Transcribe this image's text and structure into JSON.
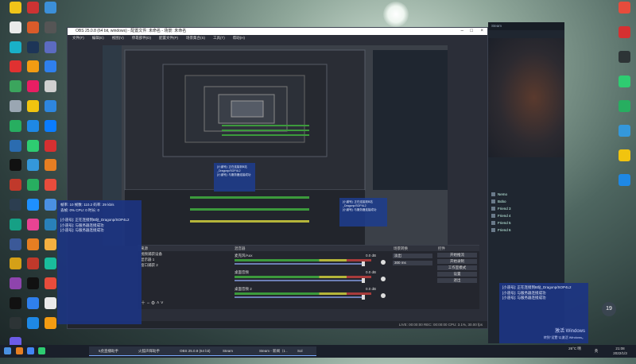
{
  "desktop_left_icons": [
    {
      "label": "",
      "color": "#f0c419"
    },
    {
      "label": "",
      "color": "#cc3333"
    },
    {
      "label": "",
      "color": "#3c8fd8"
    },
    {
      "label": "",
      "color": "#eaeaea"
    },
    {
      "label": "",
      "color": "#d95b2a"
    },
    {
      "label": "",
      "color": "#555555"
    },
    {
      "label": "",
      "color": "#19b0c8"
    },
    {
      "label": "",
      "color": "#1d3557"
    },
    {
      "label": "",
      "color": "#5c6bc0"
    },
    {
      "label": "",
      "color": "#e03131"
    },
    {
      "label": "",
      "color": "#f39c12"
    },
    {
      "label": "",
      "color": "#2f80ed"
    },
    {
      "label": "",
      "color": "#3ba55d"
    },
    {
      "label": "",
      "color": "#e91e63"
    },
    {
      "label": "",
      "color": "#d0d0d0"
    },
    {
      "label": "",
      "color": "#9aa6b2"
    },
    {
      "label": "",
      "color": "#f1c40f"
    },
    {
      "label": "",
      "color": "#2e86de"
    },
    {
      "label": "",
      "color": "#27ae60"
    },
    {
      "label": "",
      "color": "#1e88e5"
    },
    {
      "label": "",
      "color": "#0a7cff"
    },
    {
      "label": "",
      "color": "#2b6cb0"
    },
    {
      "label": "",
      "color": "#2ecc71"
    },
    {
      "label": "",
      "color": "#d63031"
    },
    {
      "label": "",
      "color": "#111111"
    },
    {
      "label": "",
      "color": "#3498db"
    },
    {
      "label": "",
      "color": "#e67e22"
    },
    {
      "label": "",
      "color": "#c0392b"
    },
    {
      "label": "",
      "color": "#27ae60"
    },
    {
      "label": "",
      "color": "#e74c3c"
    },
    {
      "label": "",
      "color": "#2c3e50"
    },
    {
      "label": "",
      "color": "#1e90ff"
    },
    {
      "label": "",
      "color": "#4a90e2"
    },
    {
      "label": "",
      "color": "#16a085"
    },
    {
      "label": "",
      "color": "#e84393"
    },
    {
      "label": "",
      "color": "#2980b9"
    },
    {
      "label": "",
      "color": "#3b5998"
    },
    {
      "label": "",
      "color": "#e67e22"
    },
    {
      "label": "",
      "color": "#f5b041"
    },
    {
      "label": "",
      "color": "#d4a017"
    },
    {
      "label": "",
      "color": "#c0392b"
    },
    {
      "label": "",
      "color": "#1abc9c"
    },
    {
      "label": "",
      "color": "#8e44ad"
    },
    {
      "label": "",
      "color": "#111111"
    },
    {
      "label": "",
      "color": "#e74c3c"
    },
    {
      "label": "",
      "color": "#111111"
    },
    {
      "label": "",
      "color": "#2f80ed"
    },
    {
      "label": "",
      "color": "#eaeaea"
    },
    {
      "label": "",
      "color": "#2d3436"
    },
    {
      "label": "",
      "color": "#1e88e5"
    },
    {
      "label": "",
      "color": "#f39c12"
    },
    {
      "label": "",
      "color": "#6c5ce7"
    }
  ],
  "desktop_right_icons": [
    {
      "label": "",
      "color": "#e74c3c"
    },
    {
      "label": "",
      "color": "#d63031"
    },
    {
      "label": "",
      "color": "#2d3436"
    },
    {
      "label": "",
      "color": "#2ecc71"
    },
    {
      "label": "",
      "color": "#27ae60"
    },
    {
      "label": "",
      "color": "#3498db"
    },
    {
      "label": "",
      "color": "#f1c40f"
    },
    {
      "label": "",
      "color": "#1e88e5"
    }
  ],
  "obs": {
    "title": "OBS 25.0.8 (64 bit, windows) - 配置文件: 未命名 - 场景: 未命名",
    "menu": [
      "文件(F)",
      "编辑(E)",
      "视图(V)",
      "停靠部件(D)",
      "配置文件(P)",
      "场景集合(S)",
      "工具(T)",
      "帮助(H)"
    ],
    "scenes_title": "场景",
    "sources_title": "来源",
    "sources": [
      "视频捕获设备",
      "显示器 1",
      "窗口捕获 2"
    ],
    "mixer_title": "混音器",
    "mixer_channels": [
      {
        "name": "麦克风/Aux",
        "db": "0.0 dB"
      },
      {
        "name": "桌面音频",
        "db": "0.0 dB"
      },
      {
        "name": "桌面音频 2",
        "db": "0.0 dB"
      }
    ],
    "transitions_title": "场景转换",
    "transition_select": "淡出",
    "transition_duration": "300 ms",
    "controls_title": "控件",
    "controls": [
      "开始推流",
      "开始录制",
      "工作室模式",
      "设置",
      "退出"
    ],
    "status": "LIVE: 00:00:00   REC: 00:00:00   CPU: 3.1%, 30.00 fps"
  },
  "notifications": [
    {
      "lines": [
        "[小道号]: 正在连接到B站_Dragonp/SOP4L2",
        "[小道号]: 与服务器连接成功",
        "[小道号]: 与服务器连接成功"
      ]
    },
    {
      "lines": [
        "[小道号]: 正在连接到B站_Dragonp/SOP4L2",
        "[小道号]: 与服务器连接成功",
        "[小道号]: 与服务器连接成功"
      ]
    }
  ],
  "overlay_stats": {
    "row1": "帧率: 10   帧数: 110.2   码率: 29 kb/s",
    "row2": "丢帧: 0%   CPU: 0   时长: 0"
  },
  "steam": {
    "header": "Steam",
    "friends": [
      "Nemo",
      "Bobo",
      "Friend 3",
      "Friend 4",
      "Friend 5",
      "Friend 6"
    ]
  },
  "activate_windows": {
    "line1": "激活 Windows",
    "line2": "转到\"设置\"以激活 Windows。"
  },
  "taskbar": {
    "tasks": [
      "5虎直播助手",
      "火狐声辉助手",
      "OBS 25.0.8 (64 bit)",
      "Steam",
      "Steam - 新闻（1 ...",
      "Sol"
    ],
    "clock_time": "21:08",
    "clock_date": "2022/1/3",
    "weather": "26°C 晴",
    "lang": "英"
  },
  "badge": "19"
}
